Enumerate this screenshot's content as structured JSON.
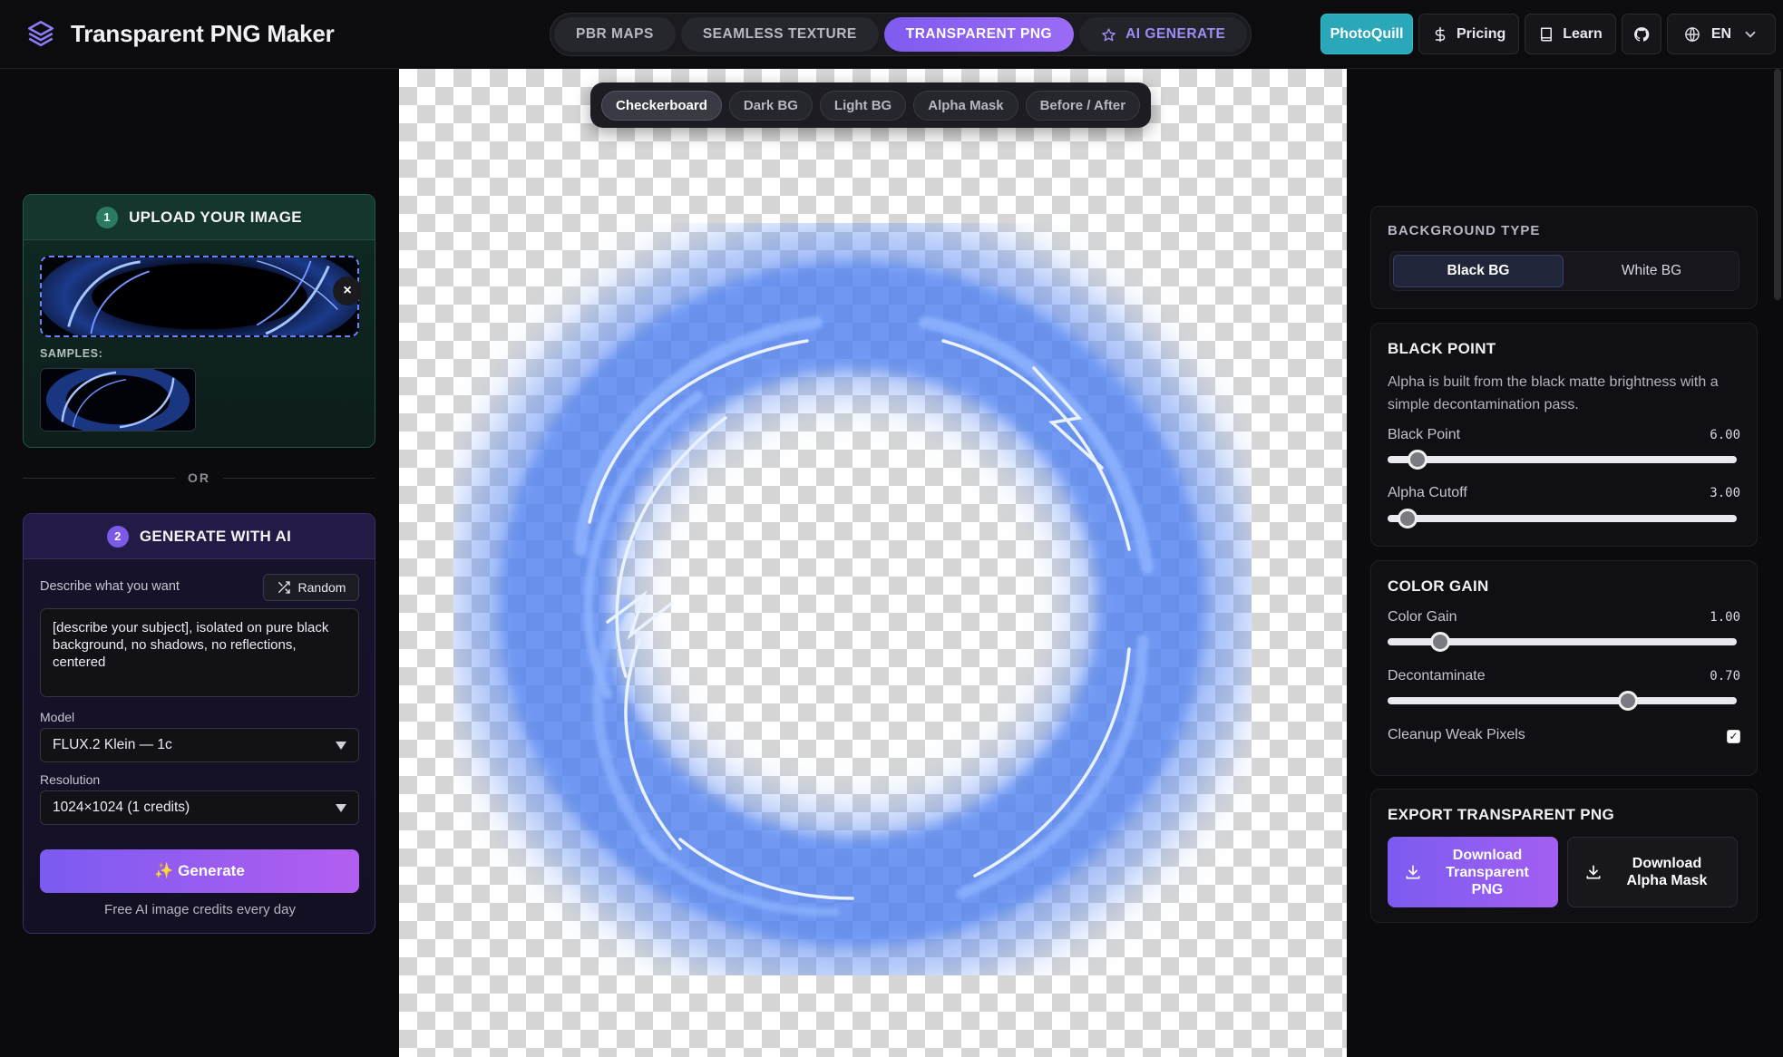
{
  "app": {
    "title": "Transparent PNG Maker"
  },
  "nav": {
    "tabs": [
      {
        "label": "PBR MAPS",
        "active": false
      },
      {
        "label": "SEAMLESS TEXTURE",
        "active": false
      },
      {
        "label": "TRANSPARENT PNG",
        "active": true
      },
      {
        "label": "AI GENERATE",
        "active": false,
        "icon": "star-icon"
      }
    ]
  },
  "header_actions": {
    "photoquill": "PhotoQuill",
    "pricing": "Pricing",
    "learn": "Learn",
    "language": "EN"
  },
  "upload": {
    "step": "1",
    "title": "UPLOAD YOUR IMAGE",
    "remove": "×",
    "samples_label": "SAMPLES:"
  },
  "or_divider": "OR",
  "generate": {
    "step": "2",
    "title": "GENERATE WITH AI",
    "describe_label": "Describe what you want",
    "random_label": "Random",
    "prompt": "[describe your subject], isolated on pure black background, no shadows, no reflections, centered",
    "model_label": "Model",
    "model_value": "FLUX.2 Klein — 1c",
    "resolution_label": "Resolution",
    "resolution_value": "1024×1024 (1 credits)",
    "button_label": "✨ Generate",
    "credits_note": "Free AI image credits every day"
  },
  "preview": {
    "view_tabs": [
      {
        "label": "Checkerboard",
        "active": true
      },
      {
        "label": "Dark BG",
        "active": false
      },
      {
        "label": "Light BG",
        "active": false
      },
      {
        "label": "Alpha Mask",
        "active": false
      },
      {
        "label": "Before / After",
        "active": false
      }
    ]
  },
  "settings": {
    "background_type": {
      "title": "BACKGROUND TYPE",
      "options": [
        {
          "label": "Black BG",
          "active": true
        },
        {
          "label": "White BG",
          "active": false
        }
      ]
    },
    "black_point": {
      "title": "BLACK POINT",
      "description": "Alpha is built from the black matte brightness with a simple decontamination pass.",
      "sliders": [
        {
          "label": "Black Point",
          "value": "6.00",
          "fraction": 0.06
        },
        {
          "label": "Alpha Cutoff",
          "value": "3.00",
          "fraction": 0.03
        }
      ]
    },
    "color_gain": {
      "title": "COLOR GAIN",
      "sliders": [
        {
          "label": "Color Gain",
          "value": "1.00",
          "fraction": 0.13
        },
        {
          "label": "Decontaminate",
          "value": "0.70",
          "fraction": 0.7
        }
      ],
      "cleanup_label": "Cleanup Weak Pixels",
      "cleanup_checked": true
    },
    "export": {
      "title": "EXPORT TRANSPARENT PNG",
      "download_png": "Download Transparent PNG",
      "download_mask": "Download Alpha Mask"
    }
  },
  "colors": {
    "accent": "#7b5bf1",
    "teal": "#2aa7b8",
    "upload_card": "#0f2a24",
    "generate_card": "#17122a",
    "vortex": "#4f80f0"
  }
}
